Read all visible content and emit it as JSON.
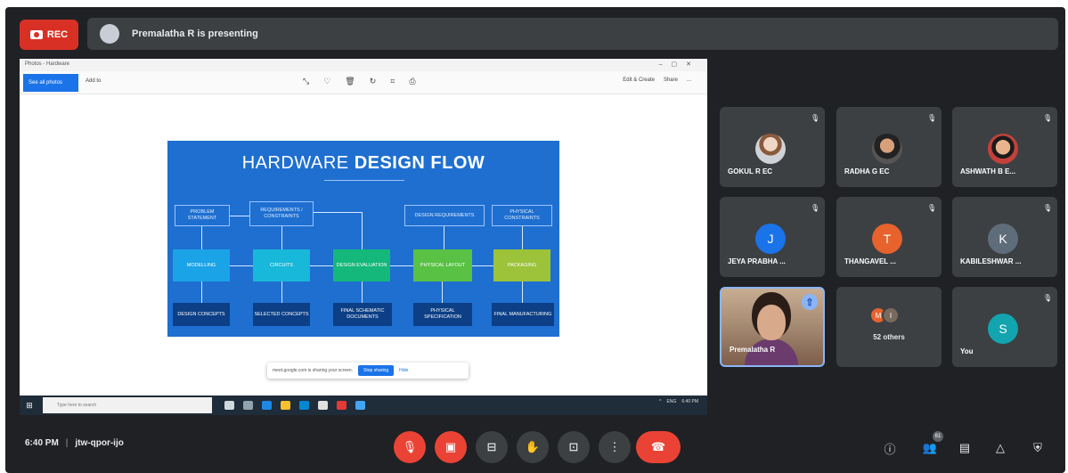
{
  "recording": {
    "label": "REC"
  },
  "presenter_banner": {
    "text": "Premalatha R is presenting"
  },
  "shared_screen": {
    "window_title": "Photos - Hardware",
    "toolbar": {
      "see_all": "See all photos",
      "add_to": "Add to",
      "right_tools": [
        "Edit & Create",
        "Share",
        "..."
      ]
    },
    "slide": {
      "title_plain": "HARDWARE ",
      "title_bold": "DESIGN FLOW",
      "row1": [
        "PROBLEM STATEMENT",
        "REQUIREMENTS / CONSTRAINTS",
        "DESIGN REQUIREMENTS",
        "PHYSICAL CONSTRAINTS"
      ],
      "row2": [
        "MODELLING",
        "CIRCUITS",
        "DESIGN EVALUATION",
        "PHYSICAL LAYOUT",
        "PACKAGING"
      ],
      "row3": [
        "DESIGN CONCEPTS",
        "SELECTED CONCEPTS",
        "FINAL SCHEMATIC DOCUMENTS",
        "PHYSICAL SPECIFICATION",
        "FINAL MANUFACTURING"
      ]
    },
    "sharing_banner": {
      "text": "meet.google.com is sharing your screen.",
      "stop": "Stop sharing",
      "hide": "Hide"
    },
    "taskbar": {
      "search_placeholder": "Type here to search",
      "tray": [
        "^",
        "ENG",
        "6:40 PM"
      ]
    }
  },
  "participants": [
    {
      "name": "GOKUL R EC",
      "avatar": "photo"
    },
    {
      "name": "RADHA G EC",
      "avatar": "photo2"
    },
    {
      "name": "ASHWATH B E...",
      "avatar": "photo3"
    },
    {
      "name": "JEYA PRABHA ...",
      "initial": "J",
      "color": "#1a73e8"
    },
    {
      "name": "THANGAVEL ...",
      "initial": "T",
      "color": "#e8622d"
    },
    {
      "name": "KABILESHWAR ...",
      "initial": "K",
      "color": "#5f6d7a"
    },
    {
      "name": "Premalatha R"
    },
    {
      "others_label": "52 others",
      "others_initials": [
        "M",
        "I"
      ]
    },
    {
      "name": "You",
      "initial": "S",
      "color": "#12a4af"
    }
  ],
  "meeting": {
    "time": "6:40 PM",
    "code": "jtw-qpor-ijo"
  },
  "controls": {
    "mic": "mic-off",
    "camera": "camera-off",
    "captions": "captions",
    "raise_hand": "hand",
    "present": "present",
    "more": "more-options",
    "end_call": "end-call",
    "participants_count": "61"
  },
  "colors": {
    "accent": "#1a73e8",
    "danger": "#ea4335",
    "surface": "#3c4043",
    "background": "#202124"
  }
}
